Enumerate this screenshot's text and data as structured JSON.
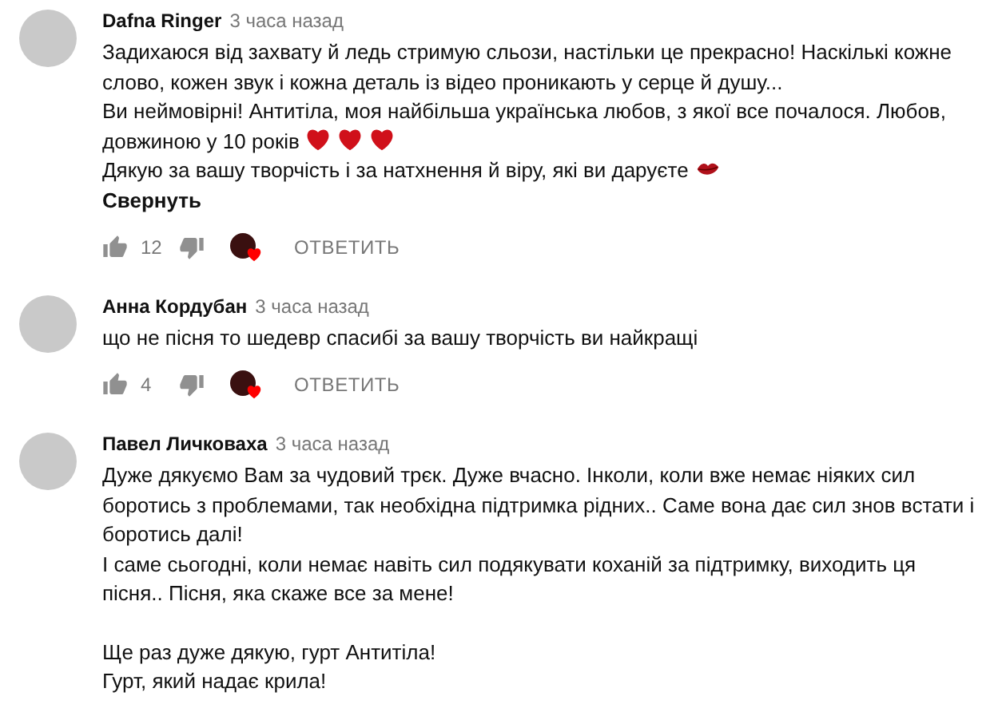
{
  "comments": [
    {
      "author": "Dafna Ringer",
      "time": "3 часа назад",
      "paragraphs": [
        {
          "text": "Задихаюся від захвату й ледь стримую сльози, настільки це прекрасно! Наскількі кожне слово, кожен звук і кожна деталь із відео проникають у серце й душу..."
        },
        {
          "text": "Ви неймовірні! Антитіла, моя найбільша українська любов, з якої все почалося. Любов, довжиною у 10 років",
          "emojis": [
            {
              "kind": "heart"
            },
            {
              "kind": "heart"
            },
            {
              "kind": "heart"
            }
          ]
        },
        {
          "text": "Дякую за вашу творчість і за натхнення й віру, які ви даруєте",
          "emojis": [
            {
              "kind": "lips"
            }
          ]
        }
      ],
      "collapse": "Свернуть",
      "likes": "12",
      "hearted": true,
      "reply": "ОТВЕТИТЬ"
    },
    {
      "author": "Анна Кордубан",
      "time": "3 часа назад",
      "paragraphs": [
        {
          "text": "що не пісня то шедевр спасибі за вашу творчість ви найкращі"
        }
      ],
      "likes": "4",
      "hearted": true,
      "reply": "ОТВЕТИТЬ"
    },
    {
      "author": "Павел Личковаха",
      "time": "3 часа назад",
      "paragraphs": [
        {
          "text": "Дуже дякуємо Вам за чудовий трєк. Дуже вчасно. Інколи, коли вже немає ніяких сил боротись з проблемами, так необхідна підтримка рідних.. Саме вона дає сил знов встати і боротись далі!"
        },
        {
          "text": "І саме сьогодні, коли немає навіть сил подякувати коханій за підтримку, виходить ця пісня..  Пісня, яка скаже все за мене!"
        },
        {
          "text": "Ще раз дуже дякую, гурт Антитіла!",
          "spaced": true
        },
        {
          "text": "Гурт, який надає крила!"
        }
      ]
    }
  ]
}
